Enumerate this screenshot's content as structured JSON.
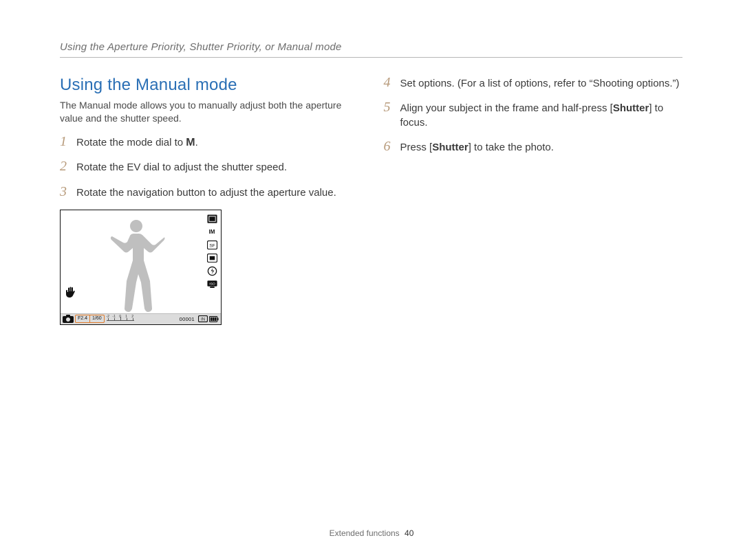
{
  "header": "Using the Aperture Priority, Shutter Priority, or Manual mode",
  "section_title": "Using the Manual mode",
  "intro": "The Manual mode allows you to manually adjust both the aperture value and the shutter speed.",
  "steps_left": {
    "n1": "1",
    "t1_pre": "Rotate the mode dial to ",
    "t1_icon": "M",
    "t1_post": ".",
    "n2": "2",
    "t2": "Rotate the EV dial to adjust the shutter speed.",
    "n3": "3",
    "t3": "Rotate the navigation button to adjust the aperture value."
  },
  "steps_right": {
    "n4": "4",
    "t4": "Set options. (For a list of options, refer to “Shooting options.”)",
    "n5": "5",
    "t5_pre": "Align your subject in the frame and half-press [",
    "t5_b": "Shutter",
    "t5_post": "] to focus.",
    "n6": "6",
    "t6_pre": "Press [",
    "t6_b": "Shutter",
    "t6_post": "] to take the photo."
  },
  "lcd": {
    "aperture": "F2.4",
    "shutter": "1/60",
    "ev_labels": [
      "-2",
      "-1",
      "0",
      "1",
      "2"
    ],
    "shots_remaining": "00001",
    "right_icons": [
      "metering-icon",
      "size-im-icon",
      "quality-sf-icon",
      "drive-icon",
      "flash-icon",
      "iso-icon"
    ],
    "size_label": "M",
    "quality_label": "SF",
    "iso_label": "ISO"
  },
  "footer": {
    "label": "Extended functions",
    "page": "40"
  }
}
